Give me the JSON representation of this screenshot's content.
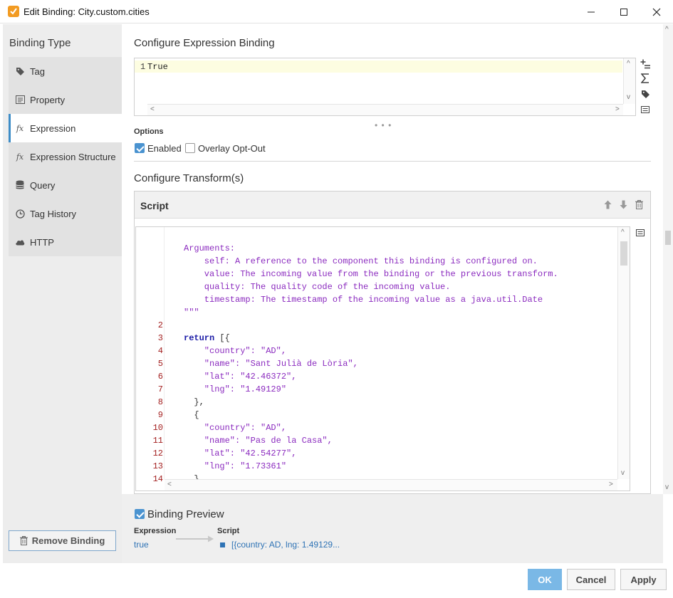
{
  "window": {
    "title": "Edit Binding: City.custom.cities"
  },
  "sidebar": {
    "heading": "Binding Type",
    "items": [
      {
        "label": "Tag",
        "icon": "tag-icon",
        "active": false
      },
      {
        "label": "Property",
        "icon": "property-icon",
        "active": false
      },
      {
        "label": "Expression",
        "icon": "fx-icon",
        "active": true
      },
      {
        "label": "Expression Structure",
        "icon": "fx-icon",
        "active": false
      },
      {
        "label": "Query",
        "icon": "database-icon",
        "active": false
      },
      {
        "label": "Tag History",
        "icon": "clock-icon",
        "active": false
      },
      {
        "label": "HTTP",
        "icon": "cloud-icon",
        "active": false
      }
    ],
    "remove_label": "Remove Binding"
  },
  "expression": {
    "section_title": "Configure Expression Binding",
    "line_number": "1",
    "code": "True"
  },
  "options": {
    "label": "Options",
    "enabled_label": "Enabled",
    "enabled_checked": true,
    "overlay_label": "Overlay Opt-Out",
    "overlay_checked": false
  },
  "transforms": {
    "section_title": "Configure Transform(s)",
    "panel_title": "Script",
    "lines": [
      {
        "num": "",
        "text": "Arguments:",
        "cls": "c-doc"
      },
      {
        "num": "",
        "text": "    self: A reference to the component this binding is configured on.",
        "cls": "c-doc"
      },
      {
        "num": "",
        "text": "    value: The incoming value from the binding or the previous transform.",
        "cls": "c-doc"
      },
      {
        "num": "",
        "text": "    quality: The quality code of the incoming value.",
        "cls": "c-doc"
      },
      {
        "num": "",
        "text": "    timestamp: The timestamp of the incoming value as a java.util.Date",
        "cls": "c-doc"
      },
      {
        "num": "",
        "text": "\"\"\"",
        "cls": "c-doc"
      },
      {
        "num": "2",
        "text": "",
        "cls": "c-pun"
      },
      {
        "num": "3",
        "text": "return [{",
        "cls": "c-kw-line"
      },
      {
        "num": "4",
        "text": "    \"country\": \"AD\",",
        "cls": "c-str"
      },
      {
        "num": "5",
        "text": "    \"name\": \"Sant Julià de Lòria\",",
        "cls": "c-str"
      },
      {
        "num": "6",
        "text": "    \"lat\": \"42.46372\",",
        "cls": "c-str"
      },
      {
        "num": "7",
        "text": "    \"lng\": \"1.49129\"",
        "cls": "c-str"
      },
      {
        "num": "8",
        "text": "  },",
        "cls": "c-pun"
      },
      {
        "num": "9",
        "text": "  {",
        "cls": "c-pun"
      },
      {
        "num": "10",
        "text": "    \"country\": \"AD\",",
        "cls": "c-str"
      },
      {
        "num": "11",
        "text": "    \"name\": \"Pas de la Casa\",",
        "cls": "c-str"
      },
      {
        "num": "12",
        "text": "    \"lat\": \"42.54277\",",
        "cls": "c-str"
      },
      {
        "num": "13",
        "text": "    \"lng\": \"1.73361\"",
        "cls": "c-str"
      },
      {
        "num": "14",
        "text": "  }",
        "cls": "c-pun"
      }
    ]
  },
  "preview": {
    "label": "Binding Preview",
    "checked": true,
    "expression_label": "Expression",
    "expression_value": "true",
    "script_label": "Script",
    "script_value": "[{country: AD, lng: 1.49129..."
  },
  "footer": {
    "ok_label": "OK",
    "cancel_label": "Cancel",
    "apply_label": "Apply"
  },
  "colors": {
    "accent": "#3d8cc7",
    "primary_button": "#7ab8e6",
    "line_numbers": "#a32020",
    "docstring": "#8b2bbf",
    "keyword": "#1a1aa6"
  }
}
